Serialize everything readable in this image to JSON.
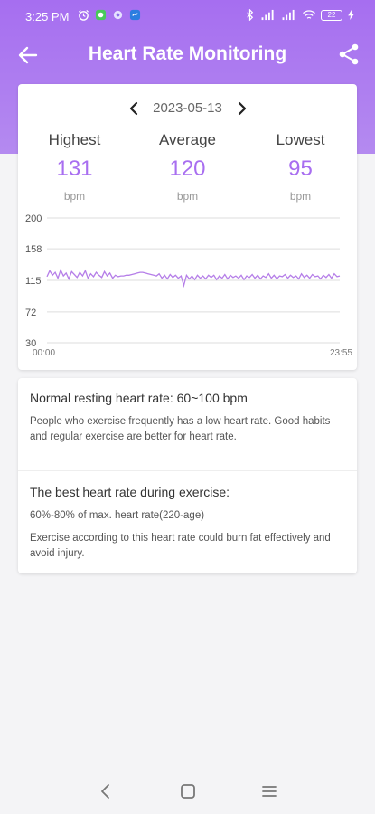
{
  "status": {
    "time": "3:25 PM",
    "battery": "22"
  },
  "app_bar": {
    "title": "Heart Rate Monitoring",
    "back_icon": "arrow-left-icon",
    "share_icon": "share-icon"
  },
  "date": {
    "value": "2023-05-13"
  },
  "stats": {
    "highest": {
      "label": "Highest",
      "value": "131",
      "unit": "bpm"
    },
    "average": {
      "label": "Average",
      "value": "120",
      "unit": "bpm"
    },
    "lowest": {
      "label": "Lowest",
      "value": "95",
      "unit": "bpm"
    }
  },
  "chart_data": {
    "type": "line",
    "y_ticks": [
      "200",
      "158",
      "115",
      "72",
      "30"
    ],
    "ylim": [
      30,
      200
    ],
    "x_labels": [
      "00:00",
      "23:55"
    ],
    "grid": true,
    "color": "#b57ee8",
    "series": [
      {
        "values": [
          120,
          128,
          122,
          126,
          118,
          129,
          121,
          125,
          117,
          127,
          123,
          119,
          126,
          121,
          128,
          118,
          124,
          120,
          126,
          122,
          119,
          127,
          121,
          125,
          118,
          122,
          120,
          121,
          121,
          122,
          122,
          123,
          124,
          125,
          126,
          126,
          125,
          124,
          123,
          122,
          121,
          124,
          118,
          122,
          117,
          123,
          119,
          122,
          118,
          121,
          108,
          122,
          117,
          121,
          116,
          122,
          118,
          121,
          117,
          122,
          119,
          122,
          116,
          121,
          118,
          123,
          117,
          122,
          119,
          121,
          118,
          122,
          116,
          121,
          119,
          123,
          118,
          122,
          117,
          121,
          119,
          124,
          118,
          122,
          117,
          121,
          120,
          123,
          118,
          122,
          119,
          121,
          117,
          124,
          119,
          122,
          118,
          123,
          120,
          121,
          117,
          122,
          119,
          123,
          118,
          124,
          120,
          121
        ]
      }
    ]
  },
  "info": {
    "resting_title": "Normal resting heart rate: 60~100 bpm",
    "resting_desc": "People who exercise frequently has a low heart rate. Good habits and regular exercise are better for heart rate.",
    "exercise_title": "The best heart rate during exercise:",
    "exercise_formula": "60%-80% of max. heart rate(220-age)",
    "exercise_desc": "Exercise according to this heart rate could burn fat effectively and avoid injury."
  },
  "colors": {
    "accent": "#a86ef0",
    "header": "#a66ef0"
  }
}
